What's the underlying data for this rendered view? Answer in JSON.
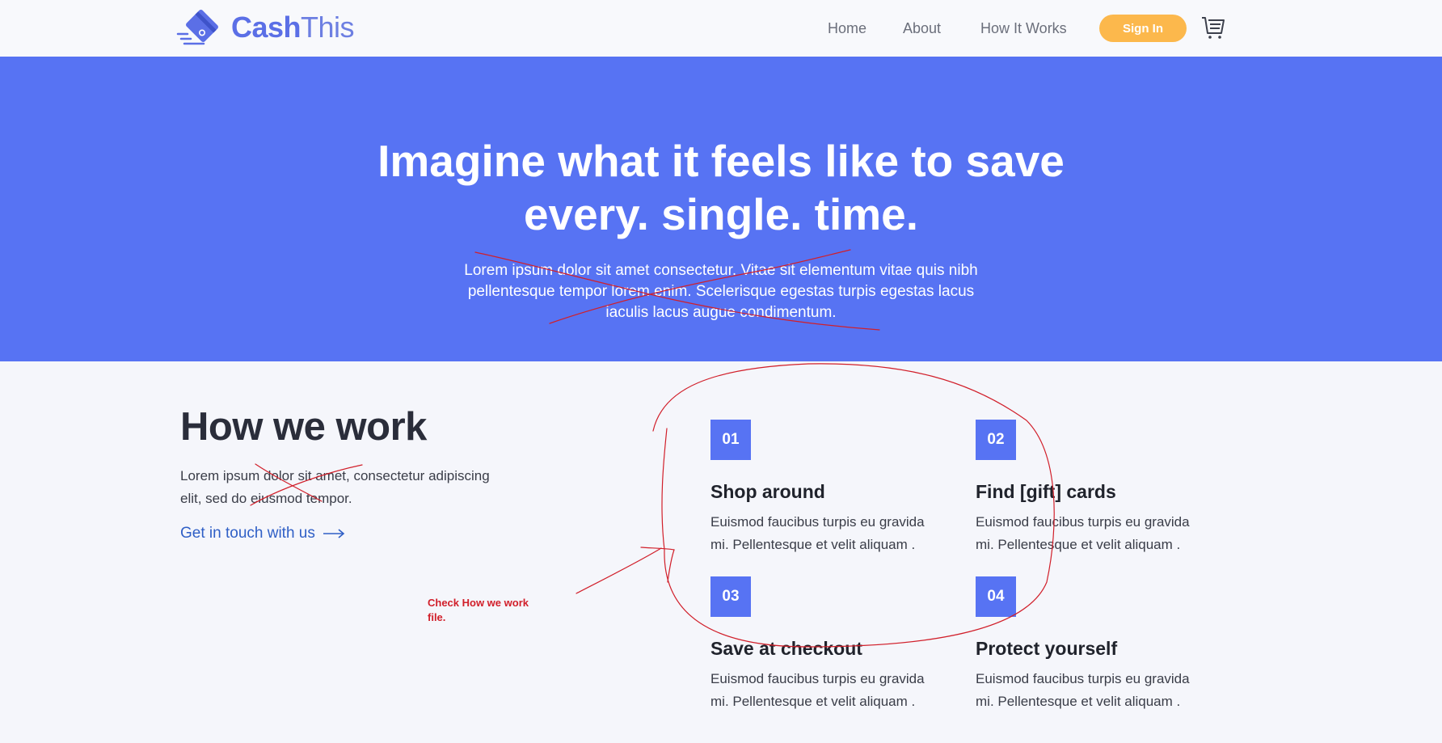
{
  "header": {
    "logo_cash": "Cash",
    "logo_this": "This",
    "nav": [
      "Home",
      "About",
      "How It Works"
    ],
    "signin_label": "Sign In",
    "accent_color": "#5773f3",
    "signin_color": "#fcb84c",
    "logo_icon": "credit-card-logo-icon",
    "cart_icon": "cart-icon"
  },
  "hero": {
    "title_line1": "Imagine what it feels like to save",
    "title_line2": "every. single. time.",
    "text_line1": "Lorem ipsum dolor sit amet consectetur. Vitae sit elementum vitae quis nibh",
    "text_line2": "pellentesque tempor lorem enim. Scelerisque egestas turpis egestas lacus",
    "text_line3": "iaculis lacus augue condimentum."
  },
  "how_we_work": {
    "title": "How we work",
    "text_line1": "Lorem ipsum dolor sit amet, consectetur adipiscing",
    "text_line2": "elit, sed do eiusmod tempor.",
    "link_label": "Get in touch with us",
    "arrow_icon": "arrow-right-icon",
    "steps": [
      {
        "number": "01",
        "title": "Shop around",
        "desc_line1": "Euismod faucibus turpis eu gravida",
        "desc_line2": "mi. Pellentesque et velit aliquam ."
      },
      {
        "number": "02",
        "title": "Find [gift] cards",
        "desc_line1": "Euismod faucibus turpis eu gravida",
        "desc_line2": "mi. Pellentesque et velit aliquam ."
      },
      {
        "number": "03",
        "title": "Save at checkout",
        "desc_line1": "Euismod faucibus turpis eu gravida",
        "desc_line2": "mi. Pellentesque et velit aliquam ."
      },
      {
        "number": "04",
        "title": "Protect yourself",
        "desc_line1": "Euismod faucibus turpis eu gravida",
        "desc_line2": "mi. Pellentesque et velit aliquam ."
      }
    ]
  },
  "annotation": {
    "note_line1": "Check How we work",
    "note_line2": "file.",
    "ink_color": "#d11f2a"
  }
}
